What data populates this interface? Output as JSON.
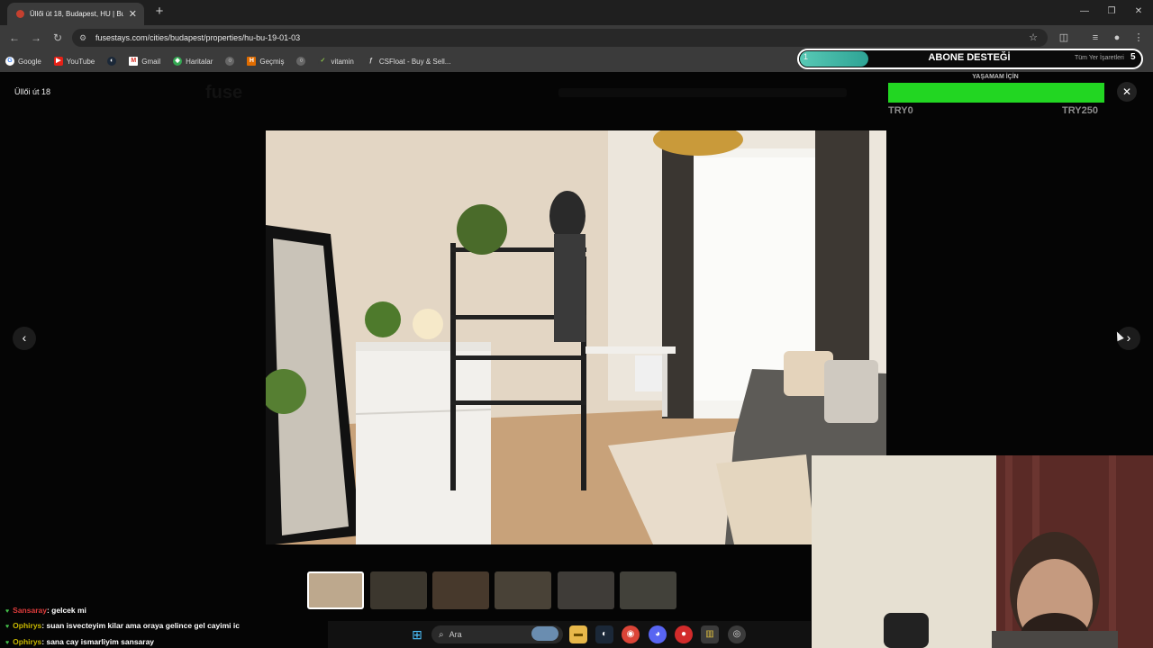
{
  "browser": {
    "tab_title": "Üllői út 18, Budapest, HU | Buda",
    "url": "fusestays.com/cities/budapest/properties/hu-bu-19-01-03",
    "bookmarks": [
      "Google",
      "YouTube",
      "Gmail",
      "Haritalar",
      "Geçmiş",
      "vitamin",
      "CSFloat - Buy & Sell..."
    ],
    "all_bookmarks_label": "Tüm Yer İşaretleri"
  },
  "sub_goal": {
    "title": "ABONE DESTEĞİ",
    "current": "1",
    "target": "5",
    "progress": 0.2
  },
  "donation_goal": {
    "title": "YAŞAMAM İÇİN",
    "min_label": "TRY0",
    "max_label": "TRY250"
  },
  "gallery": {
    "title": "Üllői út 18",
    "thumbnail_count": 6,
    "active_index": 0
  },
  "chat": [
    {
      "user": "Sansaray",
      "user_color": "#e03c3c",
      "message": ": gelcek mi"
    },
    {
      "user": "Ophirys",
      "user_color": "#c8b800",
      "message": ": suan isvecteyim kilar ama oraya gelince gel cayimi ic"
    },
    {
      "user": "Ophirys",
      "user_color": "#c8b800",
      "message": ": sana cay ismarliyim sansaray"
    }
  ],
  "taskbar": {
    "search_label": "Ara"
  },
  "icons": {
    "back": "arrow-left-icon",
    "forward": "arrow-right-icon",
    "reload": "reload-icon",
    "star": "star-icon",
    "close": "close-icon"
  }
}
